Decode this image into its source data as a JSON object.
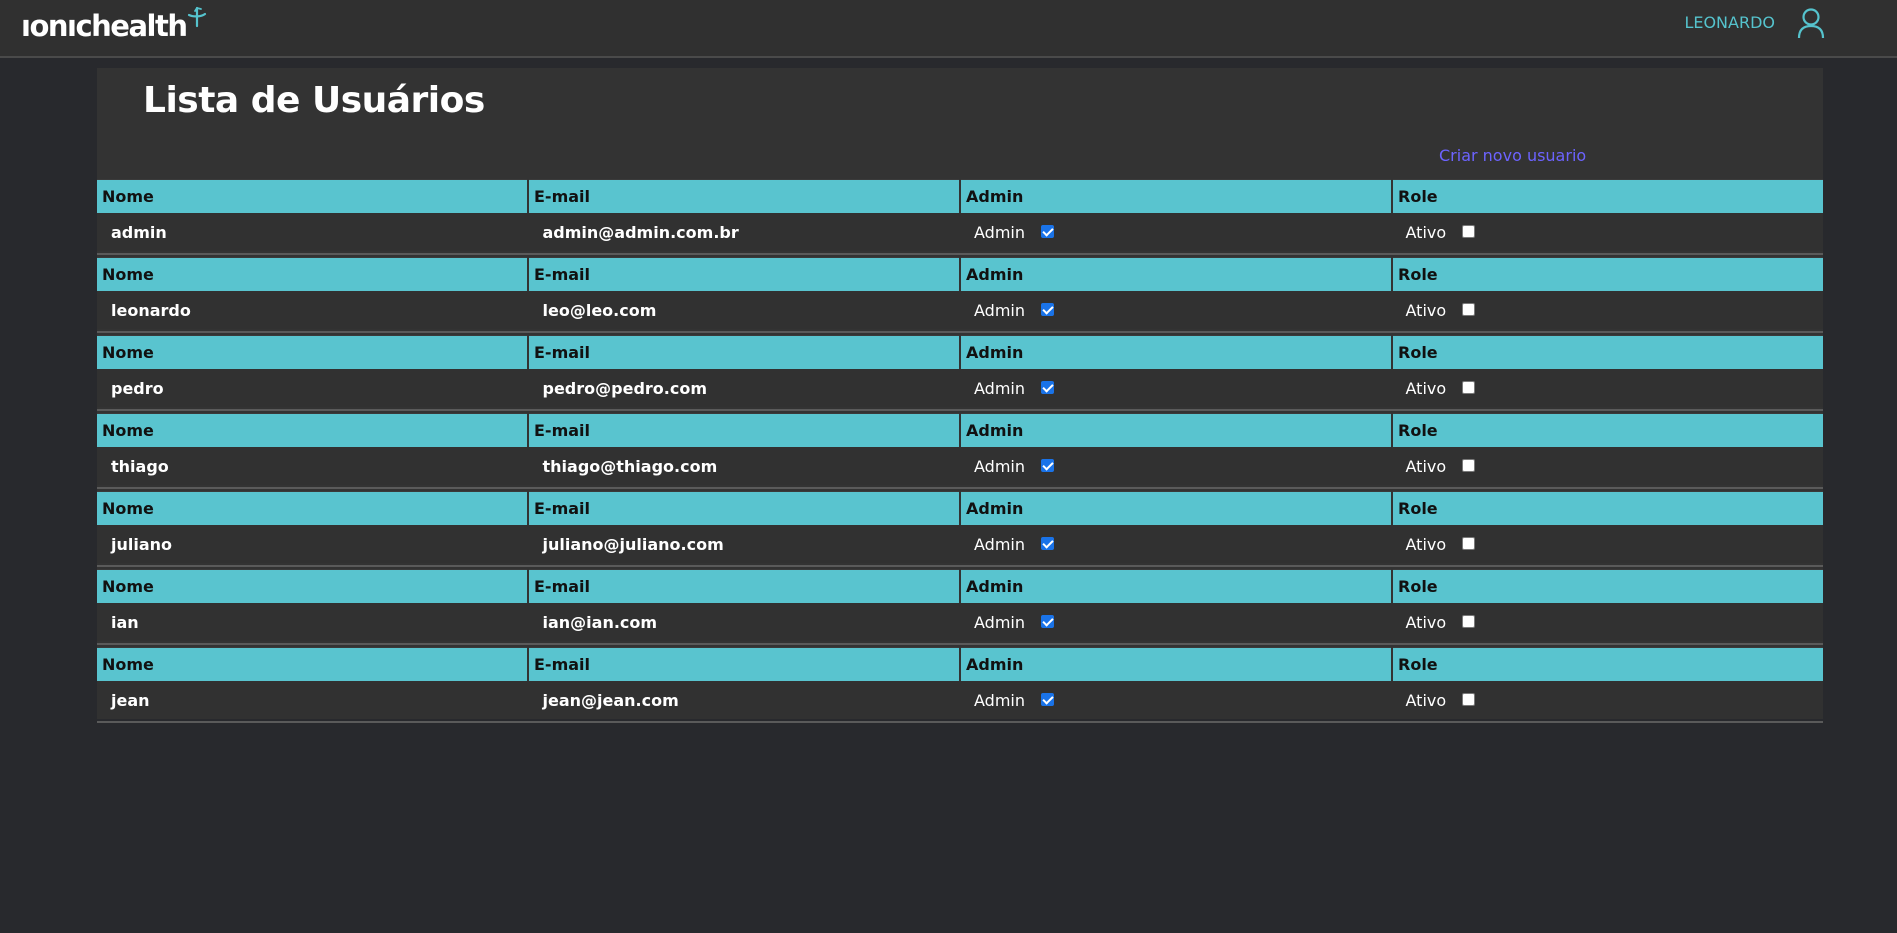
{
  "header": {
    "logo_text": "ıonıchealth",
    "user_name": "LEONARDO",
    "accent_color": "#55c3cd"
  },
  "page": {
    "title": "Lista de Usuários",
    "create_link": "Criar novo usuario"
  },
  "columns": {
    "name": "Nome",
    "email": "E-mail",
    "admin": "Admin",
    "role": "Role"
  },
  "labels": {
    "admin": "Admin",
    "active": "Ativo"
  },
  "users": [
    {
      "name": "admin",
      "email": "admin@admin.com.br",
      "admin": true,
      "active": false
    },
    {
      "name": "leonardo",
      "email": "leo@leo.com",
      "admin": true,
      "active": false
    },
    {
      "name": "pedro",
      "email": "pedro@pedro.com",
      "admin": true,
      "active": false
    },
    {
      "name": "thiago",
      "email": "thiago@thiago.com",
      "admin": true,
      "active": false
    },
    {
      "name": "juliano",
      "email": "juliano@juliano.com",
      "admin": true,
      "active": false
    },
    {
      "name": "ian",
      "email": "ian@ian.com",
      "admin": true,
      "active": false
    },
    {
      "name": "jean",
      "email": "jean@jean.com",
      "admin": true,
      "active": false
    }
  ]
}
